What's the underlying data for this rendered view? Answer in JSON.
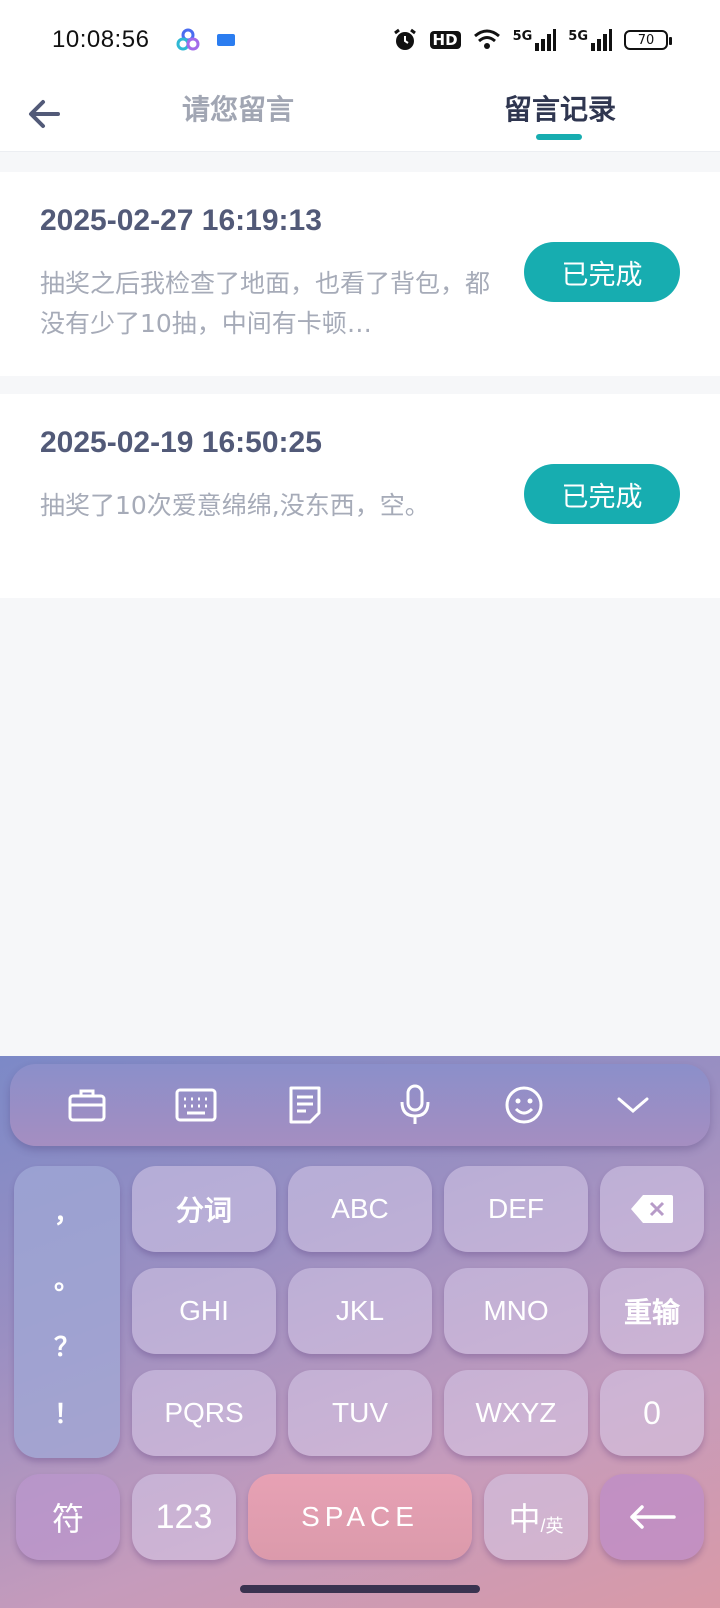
{
  "status_bar": {
    "time": "10:08:56",
    "hd_label": "HD",
    "net1": "5G",
    "net2": "5G",
    "battery": "70"
  },
  "header": {
    "tab_left": "请您留言",
    "tab_right": "留言记录"
  },
  "records": [
    {
      "datetime": "2025-02-27 16:19:13",
      "content": "抽奖之后我检查了地面，也看了背包，都没有少了10抽，中间有卡顿…",
      "status": "已完成"
    },
    {
      "datetime": "2025-02-19 16:50:25",
      "content": "抽奖了10次爱意绵绵,没东西，空。",
      "status": "已完成"
    }
  ],
  "keyboard": {
    "punct": [
      "，",
      "。",
      "？",
      "！"
    ],
    "row1": [
      "分词",
      "ABC",
      "DEF"
    ],
    "row2": [
      "GHI",
      "JKL",
      "MNO",
      "重输"
    ],
    "row3": [
      "PQRS",
      "TUV",
      "WXYZ",
      "0"
    ],
    "bottom": {
      "symbols": "符",
      "numbers": "123",
      "space": "SPACE",
      "lang_main": "中",
      "lang_sub": "/英"
    }
  },
  "colors": {
    "accent": "#17adb0",
    "title_text": "#2f3650"
  }
}
